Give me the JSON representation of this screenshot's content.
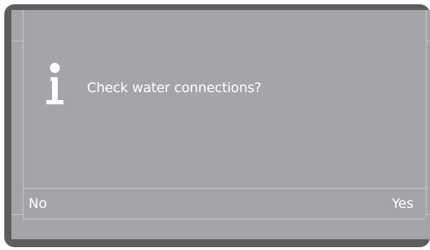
{
  "dialog": {
    "icon": "info-icon",
    "message": "Check water connections?"
  },
  "softkeys": {
    "left_label": "No",
    "right_label": "Yes"
  },
  "colors": {
    "bezel": "#5c5d5f",
    "screen": "#a4a5a8",
    "text": "#ffffff"
  }
}
